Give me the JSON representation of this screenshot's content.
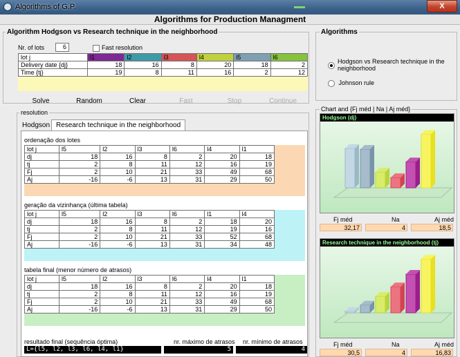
{
  "window": {
    "title": "Algorithms of G.P.",
    "close": "X"
  },
  "header": "Algorithms for Production Managment",
  "algo_group": {
    "label": "Algorithm  Hodgson vs Research technique in the neighborhood"
  },
  "nr_lots": {
    "label": "Nr. of lots",
    "value": "6"
  },
  "fast_res": "Fast resolution",
  "input_table": {
    "rows": [
      {
        "label": "lot j",
        "cells": [
          "l1",
          "l2",
          "l3",
          "l4",
          "l5",
          "l6"
        ]
      },
      {
        "label": "Delivery date {dj}",
        "cells": [
          "18",
          "16",
          "8",
          "20",
          "18",
          "2"
        ]
      },
      {
        "label": "Time {tj}",
        "cells": [
          "19",
          "8",
          "11",
          "16",
          "2",
          "12"
        ]
      }
    ],
    "colors": [
      "#7e2a92",
      "#3f9aa8",
      "#d45457",
      "#c0d040",
      "#7fa0b0",
      "#86c23e"
    ]
  },
  "buttons": {
    "solve": "Solve",
    "random": "Random",
    "clear": "Clear",
    "fast": "Fast",
    "stop": "Stop",
    "continue": "Continue"
  },
  "resolution": {
    "label": "resolution",
    "tab1": "Hodgson",
    "tab2": "Research technique in the neighborhood"
  },
  "tables": [
    {
      "title": "ordenação dos lotes",
      "bg": "#fbd8b3",
      "rows": [
        {
          "label": "lot j",
          "cells": [
            "l5",
            "l2",
            "l3",
            "l6",
            "l4",
            "l1"
          ]
        },
        {
          "label": "dj",
          "cells": [
            "18",
            "16",
            "8",
            "2",
            "20",
            "18"
          ]
        },
        {
          "label": "tj",
          "cells": [
            "2",
            "8",
            "11",
            "12",
            "16",
            "19"
          ]
        },
        {
          "label": "Fj",
          "cells": [
            "2",
            "10",
            "21",
            "33",
            "49",
            "68"
          ]
        },
        {
          "label": "Aj",
          "cells": [
            "-16",
            "-6",
            "13",
            "31",
            "29",
            "50"
          ]
        }
      ]
    },
    {
      "title": "geração da vizinhança (última tabela)",
      "bg": "#bdf2f7",
      "rows": [
        {
          "label": "lot j",
          "cells": [
            "l5",
            "l2",
            "l3",
            "l6",
            "l1",
            "l4"
          ]
        },
        {
          "label": "dj",
          "cells": [
            "18",
            "16",
            "8",
            "2",
            "18",
            "20"
          ]
        },
        {
          "label": "tj",
          "cells": [
            "2",
            "8",
            "11",
            "12",
            "19",
            "16"
          ]
        },
        {
          "label": "Fj",
          "cells": [
            "2",
            "10",
            "21",
            "33",
            "52",
            "68"
          ]
        },
        {
          "label": "Aj",
          "cells": [
            "-16",
            "-6",
            "13",
            "31",
            "34",
            "48"
          ]
        }
      ]
    },
    {
      "title": "tabela final (menor número de atrasos)",
      "bg": "#c7efc3",
      "rows": [
        {
          "label": "lot j",
          "cells": [
            "l5",
            "l2",
            "l3",
            "l6",
            "l4",
            "l1"
          ]
        },
        {
          "label": "dj",
          "cells": [
            "18",
            "16",
            "8",
            "2",
            "20",
            "18"
          ]
        },
        {
          "label": "tj",
          "cells": [
            "2",
            "8",
            "11",
            "12",
            "16",
            "19"
          ]
        },
        {
          "label": "Fj",
          "cells": [
            "2",
            "10",
            "21",
            "33",
            "49",
            "68"
          ]
        },
        {
          "label": "Aj",
          "cells": [
            "-16",
            "-6",
            "13",
            "31",
            "29",
            "50"
          ]
        }
      ]
    }
  ],
  "final": {
    "label": "resultado final (sequência óptima)",
    "seq": "L={l5, l2, l3, l6, l4, l1}",
    "max_label": "nr. máximo de atrasos",
    "max": "5",
    "min_label": "nr. mínimo de atrasos",
    "min": "4"
  },
  "algorithms": {
    "label": "Algorithms",
    "opt1": "Hodgson vs Research technique in the neighborhood",
    "opt2": "Johnson rule"
  },
  "charts_group": "Chart and {Fj méd | Na | Aj méd}",
  "chart1": {
    "title": "Hodgson (dj)",
    "fj_label": "Fj méd",
    "na_label": "Na",
    "aj_label": "Aj méd",
    "fj": "32,17",
    "na": "4",
    "aj": "18,5",
    "chart_data": {
      "type": "bar",
      "values": [
        50,
        49,
        20,
        13,
        33,
        68
      ]
    }
  },
  "chart2": {
    "title": "Research technique in the neighborhood (tj)",
    "fj_label": "Fj méd",
    "na_label": "Na",
    "aj_label": "Aj méd",
    "fj": "30,5",
    "na": "4",
    "aj": "16,83",
    "chart_data": {
      "type": "bar",
      "values": [
        2,
        10,
        21,
        33,
        49,
        68
      ]
    }
  }
}
